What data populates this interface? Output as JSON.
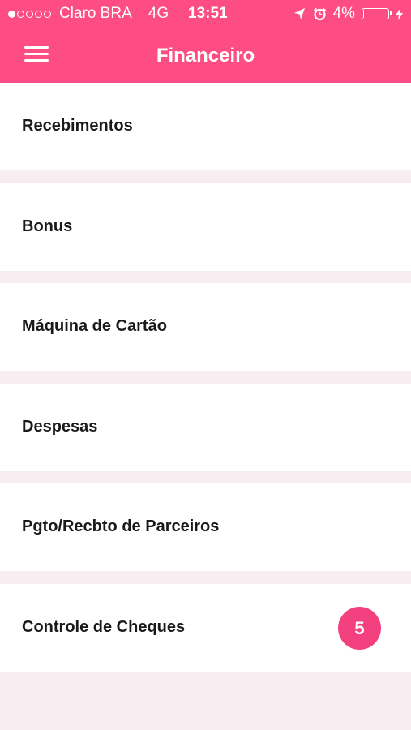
{
  "status_bar": {
    "carrier": "Claro BRA",
    "network": "4G",
    "time": "13:51",
    "battery": "4%",
    "battery_level": 0.04,
    "signal_strength": 1,
    "location_icon": "location-arrow-icon",
    "alarm_icon": "alarm-clock-icon",
    "charging_icon": "charging-bolt-icon"
  },
  "header": {
    "title": "Financeiro",
    "menu_icon": "hamburger-menu-icon"
  },
  "menu": {
    "items": [
      {
        "label": "Recebimentos"
      },
      {
        "label": "Bonus"
      },
      {
        "label": "Máquina de Cartão"
      },
      {
        "label": "Despesas"
      },
      {
        "label": "Pgto/Recbto de Parceiros"
      },
      {
        "label": "Controle de Cheques",
        "badge": "5"
      }
    ]
  },
  "colors": {
    "accent": "#fe4c85",
    "badge": "#f3407e",
    "background": "#f8eef1",
    "item_background": "#ffffff",
    "text": "#1a1a1a"
  }
}
